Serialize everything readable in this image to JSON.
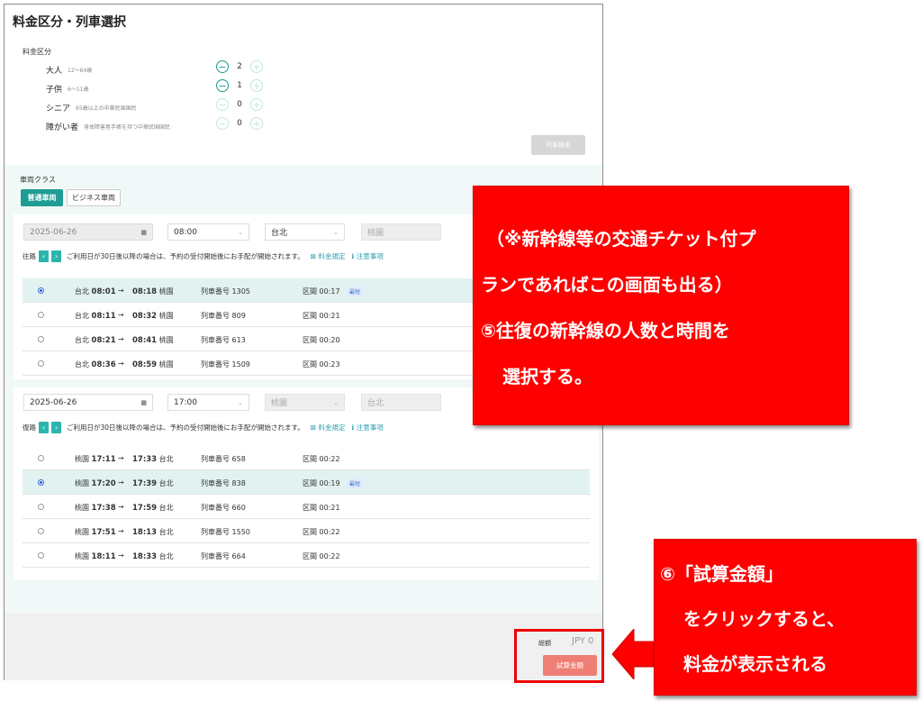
{
  "page": {
    "title": "料金区分・列車選択"
  },
  "fare": {
    "section_label": "料金区分",
    "rows": [
      {
        "name": "大人",
        "note": "12～64歳",
        "count": "2"
      },
      {
        "name": "子供",
        "note": "6～11歳",
        "count": "1"
      },
      {
        "name": "シニア",
        "note": "65歳以上の中華民国国民",
        "count": "0"
      },
      {
        "name": "障がい者",
        "note": "身体障害者手帳を持つ中華民国国民",
        "count": "0"
      }
    ],
    "search_button": "列車検索"
  },
  "car_class": {
    "label": "車両クラス",
    "tabs": [
      "普通車両",
      "ビジネス車両"
    ],
    "active": "普通車両"
  },
  "outbound": {
    "date": "2025-06-26",
    "time": "08:00",
    "from": "台北",
    "to": "桃園",
    "direction_label": "往路",
    "notice": "ご利用日が30日後以降の場合は、予約の受付開始後にお手配が開始されます。",
    "fare_rule_link": "料金規定",
    "notes_link": "注意事項",
    "trains": [
      {
        "from": "台北",
        "dep": "08:01",
        "arr": "08:18",
        "to": "桃園",
        "train_no": "列車番号 1305",
        "duration": "区間 00:17",
        "badge": "最短",
        "selected": true
      },
      {
        "from": "台北",
        "dep": "08:11",
        "arr": "08:32",
        "to": "桃園",
        "train_no": "列車番号 809",
        "duration": "区間 00:21",
        "badge": "",
        "selected": false
      },
      {
        "from": "台北",
        "dep": "08:21",
        "arr": "08:41",
        "to": "桃園",
        "train_no": "列車番号 613",
        "duration": "区間 00:20",
        "badge": "",
        "selected": false
      },
      {
        "from": "台北",
        "dep": "08:36",
        "arr": "08:59",
        "to": "桃園",
        "train_no": "列車番号 1509",
        "duration": "区間 00:23",
        "badge": "",
        "selected": false
      }
    ]
  },
  "return": {
    "date": "2025-06-26",
    "time": "17:00",
    "from": "桃園",
    "to": "台北",
    "direction_label": "復路",
    "notice": "ご利用日が30日後以降の場合は、予約の受付開始後にお手配が開始されます。",
    "fare_rule_link": "料金規定",
    "notes_link": "注意事項",
    "trains": [
      {
        "from": "桃園",
        "dep": "17:11",
        "arr": "17:33",
        "to": "台北",
        "train_no": "列車番号 658",
        "duration": "区間 00:22",
        "badge": "",
        "selected": false
      },
      {
        "from": "桃園",
        "dep": "17:20",
        "arr": "17:39",
        "to": "台北",
        "train_no": "列車番号 838",
        "duration": "区間 00:19",
        "badge": "最短",
        "selected": true
      },
      {
        "from": "桃園",
        "dep": "17:38",
        "arr": "17:59",
        "to": "台北",
        "train_no": "列車番号 660",
        "duration": "区間 00:21",
        "badge": "",
        "selected": false
      },
      {
        "from": "桃園",
        "dep": "17:51",
        "arr": "18:13",
        "to": "台北",
        "train_no": "列車番号 1550",
        "duration": "区間 00:22",
        "badge": "",
        "selected": false
      },
      {
        "from": "桃園",
        "dep": "18:11",
        "arr": "18:33",
        "to": "台北",
        "train_no": "列車番号 664",
        "duration": "区間 00:22",
        "badge": "",
        "selected": false
      }
    ]
  },
  "total": {
    "label": "総額",
    "value": "JPY 0",
    "calc_button": "試算金額"
  },
  "callout1": {
    "lines": [
      "（※新幹線等の交通チケット付プ",
      "ランであればこの画面も出る）",
      "⑤往復の新幹線の人数と時間を",
      "選択する。"
    ]
  },
  "callout2": {
    "lines": [
      "⑥「試算金額」",
      "をクリックすると、",
      "料金が表示される"
    ]
  },
  "colors": {
    "accent": "#2cb5ac",
    "callout": "#ff0000",
    "calc_button": "#ef7f75"
  },
  "icons": {
    "minus": "minus-circle-icon",
    "plus": "plus-circle-icon",
    "calendar": "calendar-icon",
    "chevron": "chevron-down-icon"
  }
}
